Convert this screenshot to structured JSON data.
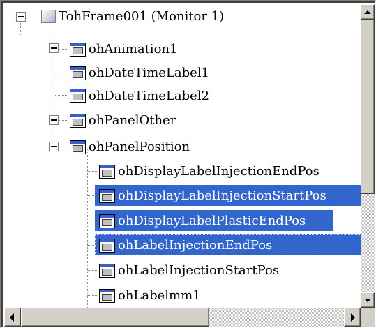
{
  "tree": {
    "nodes": [
      {
        "label": "TohFrame001 (Monitor 1)",
        "expander": "minus",
        "selected": false
      },
      {
        "label": "ohAnimation1",
        "expander": "plus",
        "selected": false
      },
      {
        "label": "ohDateTimeLabel1",
        "expander": "none",
        "selected": false
      },
      {
        "label": "ohDateTimeLabel2",
        "expander": "none",
        "selected": false
      },
      {
        "label": "ohPanelOther",
        "expander": "plus",
        "selected": false
      },
      {
        "label": "ohPanelPosition",
        "expander": "minus",
        "selected": false
      },
      {
        "label": "ohDisplayLabelInjectionEndPos",
        "expander": "none",
        "selected": false
      },
      {
        "label": "ohDisplayLabelInjectionStartPos",
        "expander": "none",
        "selected": true
      },
      {
        "label": "ohDisplayLabelPlasticEndPos",
        "expander": "none",
        "selected": true
      },
      {
        "label": "ohLabelInjectionEndPos",
        "expander": "none",
        "selected": true
      },
      {
        "label": "ohLabelInjectionStartPos",
        "expander": "none",
        "selected": false
      },
      {
        "label": "ohLabelmm1",
        "expander": "none",
        "selected": false
      }
    ]
  },
  "colors": {
    "selection": "#3366cc",
    "window_bg": "#ffffff",
    "face": "#d4d0c8"
  },
  "icons": {
    "frame": "frame-window-icon",
    "control": "control-component-icon",
    "expand": "plus-expander-icon",
    "collapse": "minus-expander-icon"
  }
}
